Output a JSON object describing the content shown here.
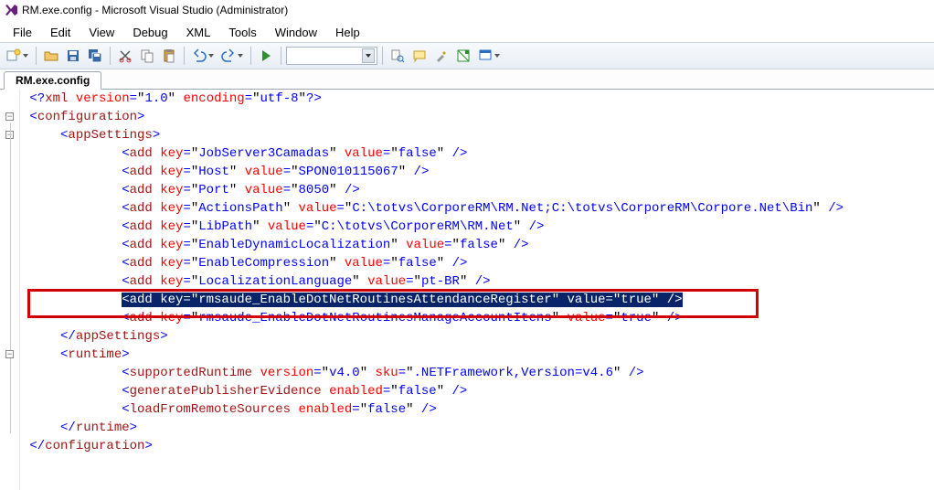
{
  "window": {
    "title": "RM.exe.config - Microsoft Visual Studio (Administrator)"
  },
  "menu": [
    "File",
    "Edit",
    "View",
    "Debug",
    "XML",
    "Tools",
    "Window",
    "Help"
  ],
  "tab": {
    "label": "RM.exe.config"
  },
  "code": {
    "lines": [
      {
        "indent": 0,
        "parts": [
          {
            "c": "t-bracket",
            "t": "<?"
          },
          {
            "c": "t-tag",
            "t": "xml "
          },
          {
            "c": "t-attr",
            "t": "version"
          },
          {
            "c": "t-eq",
            "t": "="
          },
          {
            "c": "",
            "t": "\""
          },
          {
            "c": "t-val",
            "t": "1.0"
          },
          {
            "c": "",
            "t": "\" "
          },
          {
            "c": "t-attr",
            "t": "encoding"
          },
          {
            "c": "t-eq",
            "t": "="
          },
          {
            "c": "",
            "t": "\""
          },
          {
            "c": "t-val",
            "t": "utf-8"
          },
          {
            "c": "",
            "t": "\""
          },
          {
            "c": "t-bracket",
            "t": "?>"
          }
        ]
      },
      {
        "indent": 0,
        "parts": [
          {
            "c": "t-bracket",
            "t": "<"
          },
          {
            "c": "t-tag",
            "t": "configuration"
          },
          {
            "c": "t-bracket",
            "t": ">"
          }
        ]
      },
      {
        "indent": 1,
        "parts": [
          {
            "c": "t-bracket",
            "t": "<"
          },
          {
            "c": "t-tag",
            "t": "appSettings"
          },
          {
            "c": "t-bracket",
            "t": ">"
          }
        ]
      },
      {
        "indent": 3,
        "parts": [
          {
            "c": "t-bracket",
            "t": "<"
          },
          {
            "c": "t-tag",
            "t": "add "
          },
          {
            "c": "t-attr",
            "t": "key"
          },
          {
            "c": "t-eq",
            "t": "="
          },
          {
            "c": "",
            "t": "\""
          },
          {
            "c": "t-val",
            "t": "JobServer3Camadas"
          },
          {
            "c": "",
            "t": "\" "
          },
          {
            "c": "t-attr",
            "t": "value"
          },
          {
            "c": "t-eq",
            "t": "="
          },
          {
            "c": "",
            "t": "\""
          },
          {
            "c": "t-val",
            "t": "false"
          },
          {
            "c": "",
            "t": "\" "
          },
          {
            "c": "t-bracket",
            "t": "/>"
          }
        ]
      },
      {
        "indent": 3,
        "parts": [
          {
            "c": "t-bracket",
            "t": "<"
          },
          {
            "c": "t-tag",
            "t": "add "
          },
          {
            "c": "t-attr",
            "t": "key"
          },
          {
            "c": "t-eq",
            "t": "="
          },
          {
            "c": "",
            "t": "\""
          },
          {
            "c": "t-val",
            "t": "Host"
          },
          {
            "c": "",
            "t": "\" "
          },
          {
            "c": "t-attr",
            "t": "value"
          },
          {
            "c": "t-eq",
            "t": "="
          },
          {
            "c": "",
            "t": "\""
          },
          {
            "c": "t-val",
            "t": "SPON010115067"
          },
          {
            "c": "",
            "t": "\" "
          },
          {
            "c": "t-bracket",
            "t": "/>"
          }
        ]
      },
      {
        "indent": 3,
        "parts": [
          {
            "c": "t-bracket",
            "t": "<"
          },
          {
            "c": "t-tag",
            "t": "add "
          },
          {
            "c": "t-attr",
            "t": "key"
          },
          {
            "c": "t-eq",
            "t": "="
          },
          {
            "c": "",
            "t": "\""
          },
          {
            "c": "t-val",
            "t": "Port"
          },
          {
            "c": "",
            "t": "\" "
          },
          {
            "c": "t-attr",
            "t": "value"
          },
          {
            "c": "t-eq",
            "t": "="
          },
          {
            "c": "",
            "t": "\""
          },
          {
            "c": "t-val",
            "t": "8050"
          },
          {
            "c": "",
            "t": "\" "
          },
          {
            "c": "t-bracket",
            "t": "/>"
          }
        ]
      },
      {
        "indent": 3,
        "parts": [
          {
            "c": "t-bracket",
            "t": "<"
          },
          {
            "c": "t-tag",
            "t": "add "
          },
          {
            "c": "t-attr",
            "t": "key"
          },
          {
            "c": "t-eq",
            "t": "="
          },
          {
            "c": "",
            "t": "\""
          },
          {
            "c": "t-val",
            "t": "ActionsPath"
          },
          {
            "c": "",
            "t": "\" "
          },
          {
            "c": "t-attr",
            "t": "value"
          },
          {
            "c": "t-eq",
            "t": "="
          },
          {
            "c": "",
            "t": "\""
          },
          {
            "c": "t-val",
            "t": "C:\\totvs\\CorporeRM\\RM.Net;C:\\totvs\\CorporeRM\\Corpore.Net\\Bin"
          },
          {
            "c": "",
            "t": "\" "
          },
          {
            "c": "t-bracket",
            "t": "/>"
          }
        ]
      },
      {
        "indent": 3,
        "parts": [
          {
            "c": "t-bracket",
            "t": "<"
          },
          {
            "c": "t-tag",
            "t": "add "
          },
          {
            "c": "t-attr",
            "t": "key"
          },
          {
            "c": "t-eq",
            "t": "="
          },
          {
            "c": "",
            "t": "\""
          },
          {
            "c": "t-val",
            "t": "LibPath"
          },
          {
            "c": "",
            "t": "\" "
          },
          {
            "c": "t-attr",
            "t": "value"
          },
          {
            "c": "t-eq",
            "t": "="
          },
          {
            "c": "",
            "t": "\""
          },
          {
            "c": "t-val",
            "t": "C:\\totvs\\CorporeRM\\RM.Net"
          },
          {
            "c": "",
            "t": "\" "
          },
          {
            "c": "t-bracket",
            "t": "/>"
          }
        ]
      },
      {
        "indent": 3,
        "parts": [
          {
            "c": "t-bracket",
            "t": "<"
          },
          {
            "c": "t-tag",
            "t": "add "
          },
          {
            "c": "t-attr",
            "t": "key"
          },
          {
            "c": "t-eq",
            "t": "="
          },
          {
            "c": "",
            "t": "\""
          },
          {
            "c": "t-val",
            "t": "EnableDynamicLocalization"
          },
          {
            "c": "",
            "t": "\" "
          },
          {
            "c": "t-attr",
            "t": "value"
          },
          {
            "c": "t-eq",
            "t": "="
          },
          {
            "c": "",
            "t": "\""
          },
          {
            "c": "t-val",
            "t": "false"
          },
          {
            "c": "",
            "t": "\" "
          },
          {
            "c": "t-bracket",
            "t": "/>"
          }
        ]
      },
      {
        "indent": 3,
        "parts": [
          {
            "c": "t-bracket",
            "t": "<"
          },
          {
            "c": "t-tag",
            "t": "add "
          },
          {
            "c": "t-attr",
            "t": "key"
          },
          {
            "c": "t-eq",
            "t": "="
          },
          {
            "c": "",
            "t": "\""
          },
          {
            "c": "t-val",
            "t": "EnableCompression"
          },
          {
            "c": "",
            "t": "\" "
          },
          {
            "c": "t-attr",
            "t": "value"
          },
          {
            "c": "t-eq",
            "t": "="
          },
          {
            "c": "",
            "t": "\""
          },
          {
            "c": "t-val",
            "t": "false"
          },
          {
            "c": "",
            "t": "\" "
          },
          {
            "c": "t-bracket",
            "t": "/>"
          }
        ]
      },
      {
        "indent": 3,
        "obscured": true,
        "parts": [
          {
            "c": "t-bracket",
            "t": "<"
          },
          {
            "c": "t-tag",
            "t": "add "
          },
          {
            "c": "t-attr",
            "t": "key"
          },
          {
            "c": "t-eq",
            "t": "="
          },
          {
            "c": "",
            "t": "\""
          },
          {
            "c": "t-val",
            "t": "LocalizationLanguage"
          },
          {
            "c": "",
            "t": "\" "
          },
          {
            "c": "t-attr",
            "t": "value"
          },
          {
            "c": "t-eq",
            "t": "="
          },
          {
            "c": "",
            "t": "\""
          },
          {
            "c": "t-val",
            "t": "pt-BR"
          },
          {
            "c": "",
            "t": "\" "
          },
          {
            "c": "t-bracket",
            "t": "/>"
          }
        ]
      },
      {
        "indent": 3,
        "highlight": true,
        "parts": [
          {
            "c": "",
            "t": "<add key=\"rmsaude_EnableDotNetRoutinesAttendanceRegister\" value=\"true\" />"
          }
        ]
      },
      {
        "indent": 3,
        "obscured": true,
        "parts": [
          {
            "c": "t-bracket",
            "t": "<"
          },
          {
            "c": "t-tag",
            "t": "add "
          },
          {
            "c": "t-attr",
            "t": "key"
          },
          {
            "c": "t-eq",
            "t": "="
          },
          {
            "c": "",
            "t": "\""
          },
          {
            "c": "t-val",
            "t": "rmsaude_EnableDotNetRoutinesManageAccountItens"
          },
          {
            "c": "",
            "t": "\" "
          },
          {
            "c": "t-attr",
            "t": "value"
          },
          {
            "c": "t-eq",
            "t": "="
          },
          {
            "c": "",
            "t": "\""
          },
          {
            "c": "t-val",
            "t": "true"
          },
          {
            "c": "",
            "t": "\" "
          },
          {
            "c": "t-bracket",
            "t": "/>"
          }
        ]
      },
      {
        "indent": 1,
        "parts": [
          {
            "c": "t-bracket",
            "t": "</"
          },
          {
            "c": "t-tag",
            "t": "appSettings"
          },
          {
            "c": "t-bracket",
            "t": ">"
          }
        ]
      },
      {
        "indent": 1,
        "parts": [
          {
            "c": "t-bracket",
            "t": "<"
          },
          {
            "c": "t-tag",
            "t": "runtime"
          },
          {
            "c": "t-bracket",
            "t": ">"
          }
        ]
      },
      {
        "indent": 3,
        "parts": [
          {
            "c": "t-bracket",
            "t": "<"
          },
          {
            "c": "t-tag",
            "t": "supportedRuntime "
          },
          {
            "c": "t-attr",
            "t": "version"
          },
          {
            "c": "t-eq",
            "t": "="
          },
          {
            "c": "",
            "t": "\""
          },
          {
            "c": "t-val",
            "t": "v4.0"
          },
          {
            "c": "",
            "t": "\" "
          },
          {
            "c": "t-attr",
            "t": "sku"
          },
          {
            "c": "t-eq",
            "t": "="
          },
          {
            "c": "",
            "t": "\""
          },
          {
            "c": "t-val",
            "t": ".NETFramework,Version=v4.6"
          },
          {
            "c": "",
            "t": "\" "
          },
          {
            "c": "t-bracket",
            "t": "/>"
          }
        ]
      },
      {
        "indent": 3,
        "parts": [
          {
            "c": "t-bracket",
            "t": "<"
          },
          {
            "c": "t-tag",
            "t": "generatePublisherEvidence "
          },
          {
            "c": "t-attr",
            "t": "enabled"
          },
          {
            "c": "t-eq",
            "t": "="
          },
          {
            "c": "",
            "t": "\""
          },
          {
            "c": "t-val",
            "t": "false"
          },
          {
            "c": "",
            "t": "\" "
          },
          {
            "c": "t-bracket",
            "t": "/>"
          }
        ]
      },
      {
        "indent": 3,
        "parts": [
          {
            "c": "t-bracket",
            "t": "<"
          },
          {
            "c": "t-tag",
            "t": "loadFromRemoteSources "
          },
          {
            "c": "t-attr",
            "t": "enabled"
          },
          {
            "c": "t-eq",
            "t": "="
          },
          {
            "c": "",
            "t": "\""
          },
          {
            "c": "t-val",
            "t": "false"
          },
          {
            "c": "",
            "t": "\" "
          },
          {
            "c": "t-bracket",
            "t": "/>"
          }
        ]
      },
      {
        "indent": 1,
        "parts": [
          {
            "c": "t-bracket",
            "t": "</"
          },
          {
            "c": "t-tag",
            "t": "runtime"
          },
          {
            "c": "t-bracket",
            "t": ">"
          }
        ]
      },
      {
        "indent": 0,
        "parts": [
          {
            "c": "t-bracket",
            "t": "</"
          },
          {
            "c": "t-tag",
            "t": "configuration"
          },
          {
            "c": "t-bracket",
            "t": ">"
          }
        ]
      }
    ]
  }
}
